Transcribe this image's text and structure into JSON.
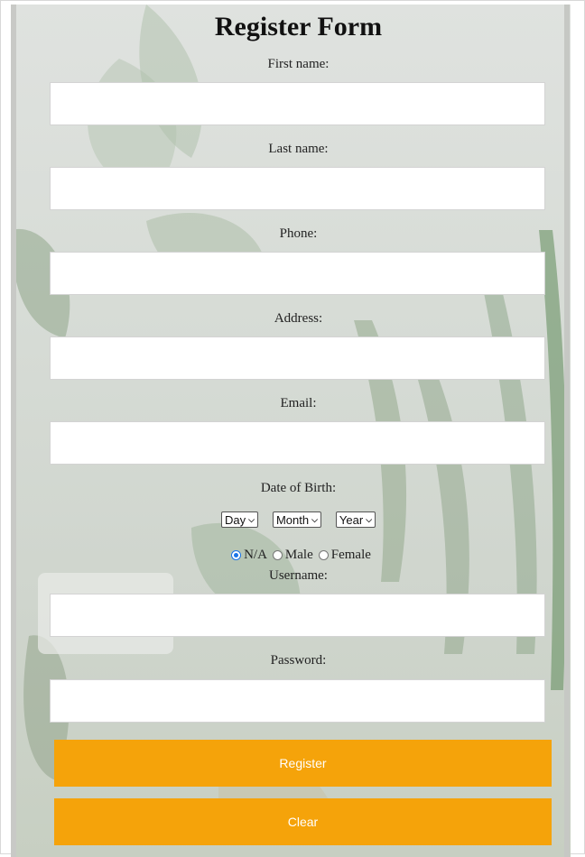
{
  "form": {
    "title": "Register Form",
    "fields": {
      "first_name": {
        "label": "First name:",
        "value": ""
      },
      "last_name": {
        "label": "Last name:",
        "value": ""
      },
      "phone": {
        "label": "Phone:",
        "value": ""
      },
      "address": {
        "label": "Address:",
        "value": ""
      },
      "email": {
        "label": "Email:",
        "value": ""
      },
      "username": {
        "label": "Username:",
        "value": ""
      },
      "password": {
        "label": "Password:",
        "value": ""
      }
    },
    "dob": {
      "label": "Date of Birth:",
      "day": "Day",
      "month": "Month",
      "year": "Year"
    },
    "gender": {
      "options": [
        "N/A",
        "Male",
        "Female"
      ],
      "selected": "N/A"
    },
    "buttons": {
      "register": "Register",
      "clear": "Clear"
    }
  },
  "colors": {
    "button_bg": "#f5a30a",
    "button_text": "#ffffff",
    "radio_selected": "#1a73e8"
  }
}
